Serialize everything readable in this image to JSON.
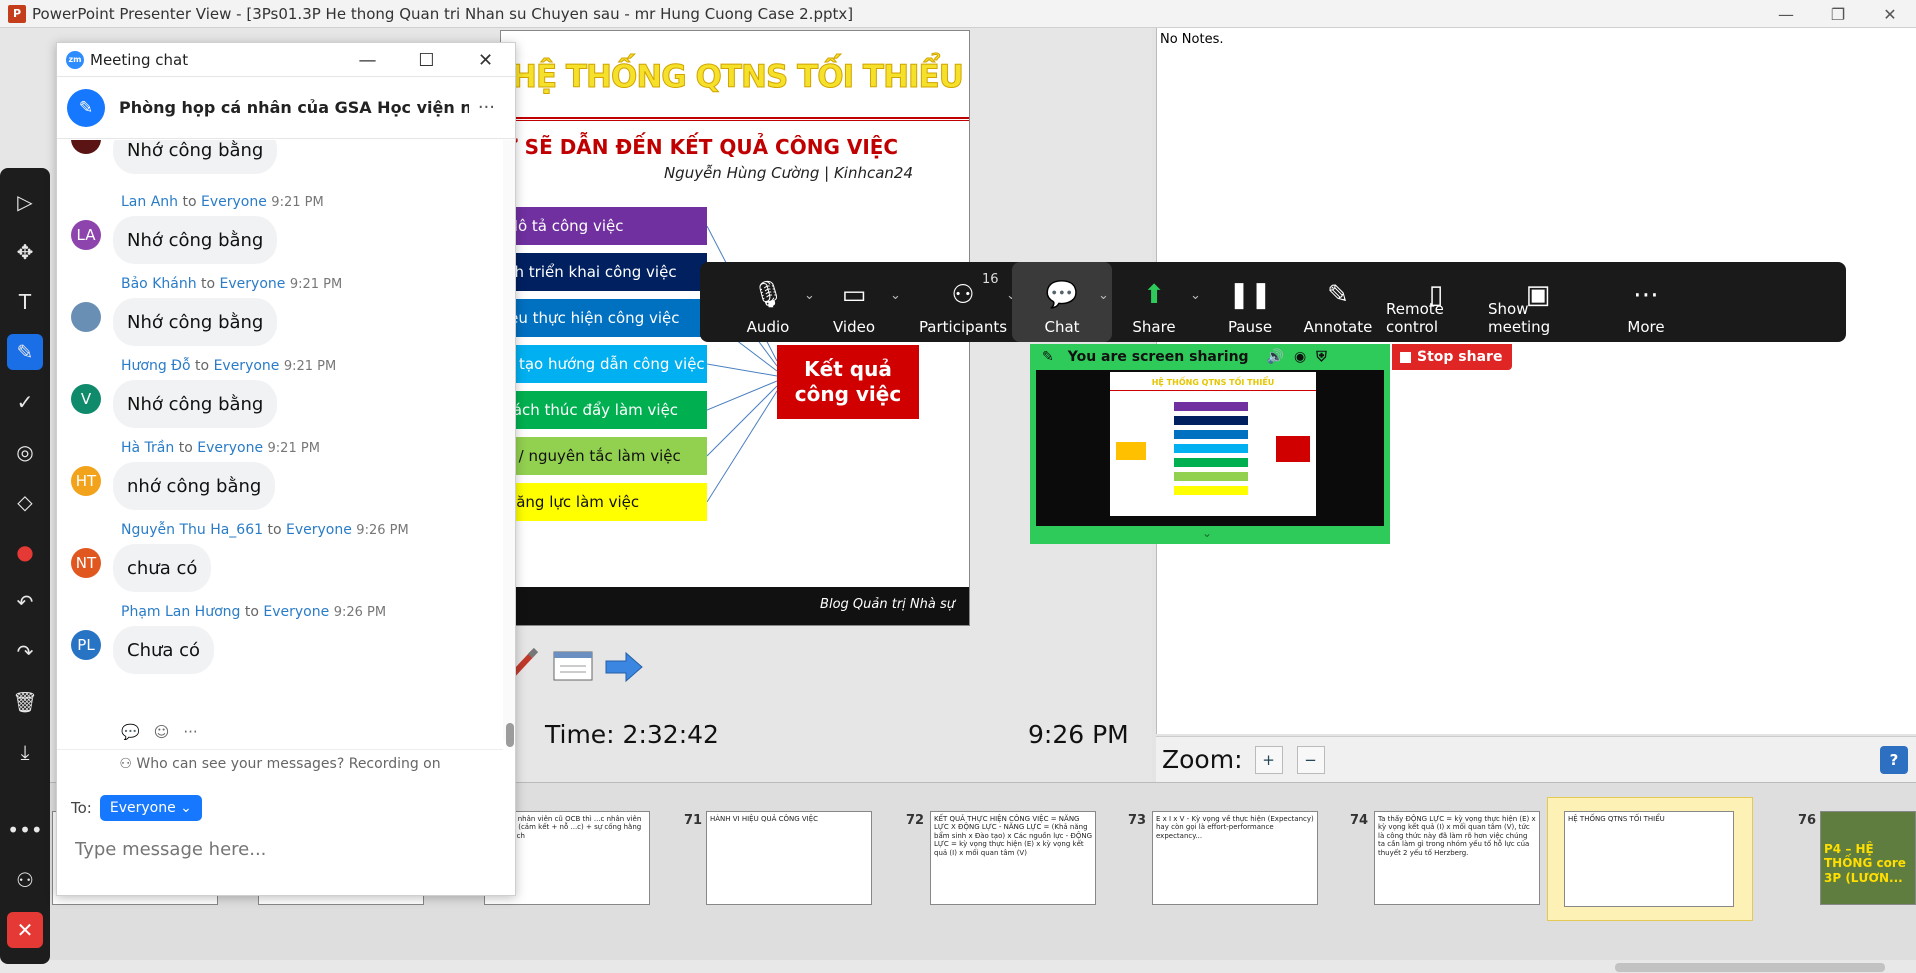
{
  "window": {
    "title": "PowerPoint Presenter View - [3Ps01.3P  He thong Quan tri Nhan su Chuyen sau - mr Hung Cuong Case 2.pptx]",
    "minimize": "—",
    "restore": "❐",
    "close": "✕"
  },
  "slide": {
    "title": "HỆ THỐNG QTNS TỐI THIỂU",
    "subtitle": "Ự SẼ DẪN ĐẾN KẾT QUẢ CÔNG VIỆC",
    "author": "Nguyễn Hùng Cường | Kinhcan24",
    "boxes": [
      {
        "label": "Mô tả công việc",
        "color": "#7030a0"
      },
      {
        "label": "nh triển khai công việc",
        "color": "#002060"
      },
      {
        "label": "iêu thực hiện công việc",
        "color": "#0070c0"
      },
      {
        "label": "o tạo hướng dẫn công việc",
        "color": "#00b0f0"
      },
      {
        "label": "sách thúc đẩy làm việc",
        "color": "#00b050"
      },
      {
        "label": "y / nguyên tắc làm việc",
        "color": "#92d050"
      },
      {
        "label": "Năng lực làm việc",
        "color": "#ffff00"
      }
    ],
    "result_line1": "Kết quả",
    "result_line2": "công việc",
    "footer": "Blog Quản trị Nhà sự"
  },
  "timer": {
    "elapsed": "Time: 2:32:42",
    "clock": "9:26 PM"
  },
  "notes": {
    "text": "No Notes."
  },
  "zoom_bar": {
    "label": "Zoom:",
    "zoom_in": "+",
    "zoom_out": "−",
    "help": "?"
  },
  "thumbnails": [
    {
      "num": "",
      "text": "...ữ cơ người khác, kết hợ là nhận của công... ...ồ động đưa ra những sáng kiến giúp cải ... công việc của bộ phận"
    },
    {
      "num": "",
      "text": "Nguyễn, đặc chấp, không cảm hệ thống thưởng, đãi ngộ của tổ chức"
    },
    {
      "num": "",
      "text": "Gắn kết nhân viên cũ OCB thì ...c nhân viên hài lòng (cảm kết + nỗ ...c) + sự cống hằng minh bạch"
    },
    {
      "num": "71",
      "text": "HÀNH VI HIỆU QUẢ CÔNG VIỆC"
    },
    {
      "num": "72",
      "text": "KẾT QUẢ THỰC HIỆN CÔNG VIỆC = NĂNG LỰC X ĐỘNG LỰC - NĂNG LỰC = (Khả năng bẩm sinh x Đào tạo) x Các nguồn lực - ĐỘNG LỰC = kỳ vọng thực hiện (E) x kỳ vọng kết quả (I) x mối quan tâm (V)"
    },
    {
      "num": "73",
      "text": "E x I x V - Kỳ vọng về thực hiện (Expectancy) hay còn gọi là effort-performance expectancy..."
    },
    {
      "num": "74",
      "text": "Ta thấy ĐỘNG LỰC = kỳ vọng thực hiện (E) x kỳ vọng kết quả (I) x mối quan tâm (V), tức là công thức này đã làm rõ hơn việc chúng ta cần làm gì trong nhóm yếu tố hỗ lực của thuyết 2 yếu tố Herzberg."
    },
    {
      "num": "75",
      "text": "HỆ THỐNG QTNS TỐI THIỂU"
    },
    {
      "num": "76",
      "text": "P4 – HỆ THỐNG core 3P (LƯƠN..."
    }
  ],
  "annotation_tools": [
    {
      "name": "select-tool",
      "icon": "▷"
    },
    {
      "name": "move-tool",
      "icon": "✥"
    },
    {
      "name": "text-tool",
      "icon": "T"
    },
    {
      "name": "draw-tool",
      "icon": "✎"
    },
    {
      "name": "stamp-tool",
      "icon": "✓"
    },
    {
      "name": "spotlight-tool",
      "icon": "◎"
    },
    {
      "name": "eraser-tool",
      "icon": "◇"
    },
    {
      "name": "format-tool",
      "icon": "●"
    },
    {
      "name": "undo-tool",
      "icon": "↶"
    },
    {
      "name": "redo-tool",
      "icon": "↷"
    },
    {
      "name": "clear-tool",
      "icon": "🗑"
    },
    {
      "name": "save-tool",
      "icon": "⤓"
    },
    {
      "name": "more-tool",
      "icon": "•••"
    },
    {
      "name": "participants-tool",
      "icon": "⚇"
    },
    {
      "name": "close-tool",
      "icon": "✕"
    }
  ],
  "chat": {
    "window_title": "Meeting chat",
    "zm_badge": "zm",
    "room_name": "Phòng họp cá nhân của GSA Học viện nhân ...",
    "more": "···",
    "first_bubble": "Nhớ công bằng",
    "messages": [
      {
        "sender": "Lan Anh",
        "to": "to",
        "recipient": "Everyone",
        "time": "9:21 PM",
        "text": "Nhớ công bằng",
        "initials": "LA",
        "color": "#8e44ad"
      },
      {
        "sender": "Bảo Khánh",
        "to": "to",
        "recipient": "Everyone",
        "time": "9:21 PM",
        "text": "Nhớ công bằng",
        "initials": "",
        "color": "#6a8fb5"
      },
      {
        "sender": "Hương Đỗ",
        "to": "to",
        "recipient": "Everyone",
        "time": "9:21 PM",
        "text": "Nhớ công bằng",
        "initials": "V",
        "color": "#0f8a6b"
      },
      {
        "sender": "Hà Trần",
        "to": "to",
        "recipient": "Everyone",
        "time": "9:21 PM",
        "text": "nhớ công bằng",
        "initials": "HT",
        "color": "#f2a31b"
      },
      {
        "sender": "Nguyễn Thu Ha_661",
        "to": "to",
        "recipient": "Everyone",
        "time": "9:26 PM",
        "text": "chưa có",
        "initials": "NT",
        "color": "#e0581f"
      },
      {
        "sender": "Phạm Lan Hương",
        "to": "to",
        "recipient": "Everyone",
        "time": "9:26 PM",
        "text": "Chưa có",
        "initials": "PL",
        "color": "#2774c4"
      }
    ],
    "privacy_notice": "Who can see your messages? Recording on",
    "to_label": "To:",
    "recipient": "Everyone",
    "input_placeholder": "Type message here..."
  },
  "zoom_toolbar": {
    "participant_count": "16",
    "buttons": [
      {
        "name": "audio",
        "label": "Audio",
        "icon": "🎙"
      },
      {
        "name": "video",
        "label": "Video",
        "icon": "▭"
      },
      {
        "name": "participants",
        "label": "Participants",
        "icon": "⚇"
      },
      {
        "name": "chat",
        "label": "Chat",
        "icon": "💬"
      },
      {
        "name": "share",
        "label": "Share",
        "icon": "⬆"
      },
      {
        "name": "pause",
        "label": "Pause",
        "icon": "❚❚"
      },
      {
        "name": "annotate",
        "label": "Annotate",
        "icon": "✎"
      },
      {
        "name": "remote-control",
        "label": "Remote control",
        "icon": "▯"
      },
      {
        "name": "show-meeting",
        "label": "Show meeting",
        "icon": "▣"
      },
      {
        "name": "more",
        "label": "More",
        "icon": "⋯"
      }
    ]
  },
  "screen_share": {
    "status": "You are screen sharing",
    "stop_label": "Stop share",
    "mini_title": "HỆ THỐNG QTNS TỐI THIỂU"
  }
}
